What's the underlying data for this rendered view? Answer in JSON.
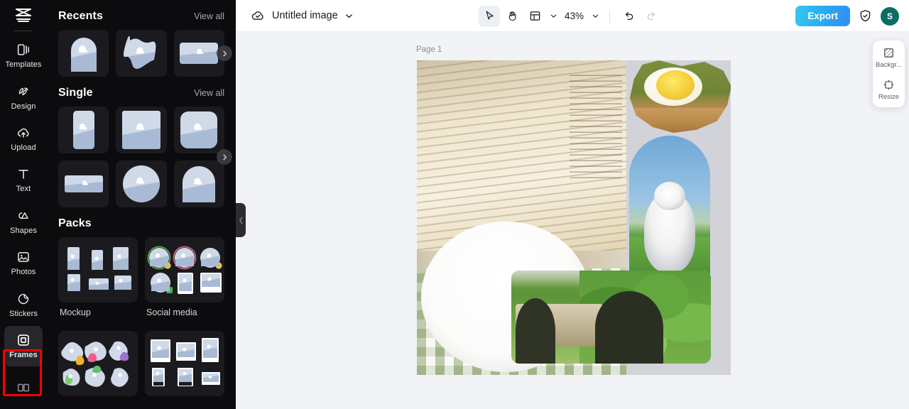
{
  "app": {
    "logo_icon": "capcut-logo-icon"
  },
  "rail": {
    "items": [
      {
        "label": "Templates",
        "icon": "templates-icon",
        "active": false
      },
      {
        "label": "Design",
        "icon": "design-icon",
        "active": false
      },
      {
        "label": "Upload",
        "icon": "upload-cloud-icon",
        "active": false
      },
      {
        "label": "Text",
        "icon": "text-icon",
        "active": false
      },
      {
        "label": "Shapes",
        "icon": "shapes-icon",
        "active": false
      },
      {
        "label": "Photos",
        "icon": "photos-icon",
        "active": false
      },
      {
        "label": "Stickers",
        "icon": "stickers-icon",
        "active": false
      },
      {
        "label": "Frames",
        "icon": "frames-icon",
        "active": true
      }
    ],
    "highlight_color": "#ff0000"
  },
  "panel": {
    "sections": [
      {
        "title": "Recents",
        "link": "View all"
      },
      {
        "title": "Single",
        "link": "View all"
      },
      {
        "title": "Packs",
        "link": ""
      }
    ],
    "packs": [
      {
        "label": "Mockup"
      },
      {
        "label": "Social media"
      },
      {
        "label": ""
      },
      {
        "label": ""
      }
    ],
    "collapse_icon": "chevron-left-icon",
    "carousel_icon": "chevron-right-icon"
  },
  "topbar": {
    "cloud_icon": "cloud-check-icon",
    "doc_title": "Untitled image",
    "doc_chevron": "chevron-down-icon",
    "tools": [
      {
        "name": "select",
        "icon": "cursor-arrow-icon",
        "selected": true
      },
      {
        "name": "hand",
        "icon": "hand-icon",
        "selected": false
      }
    ],
    "layout_icon": "layout-grid-icon",
    "layout_chevron": "chevron-down-icon",
    "zoom_level": "43%",
    "zoom_chevron": "chevron-down-icon",
    "undo_icon": "undo-icon",
    "redo_icon": "redo-icon",
    "redo_disabled": true,
    "export_label": "Export",
    "export_color": "#2aa8f2",
    "shield_icon": "shield-check-icon",
    "avatar_initial": "S",
    "avatar_color": "#0a6e62"
  },
  "stage": {
    "page_label": "Page 1",
    "background": "#f1f3f6",
    "canvas_background": "#d2d2d9"
  },
  "float_panel": {
    "items": [
      {
        "label": "Backgr...",
        "icon": "background-hatch-icon"
      },
      {
        "label": "Resize",
        "icon": "resize-crop-icon"
      }
    ]
  }
}
